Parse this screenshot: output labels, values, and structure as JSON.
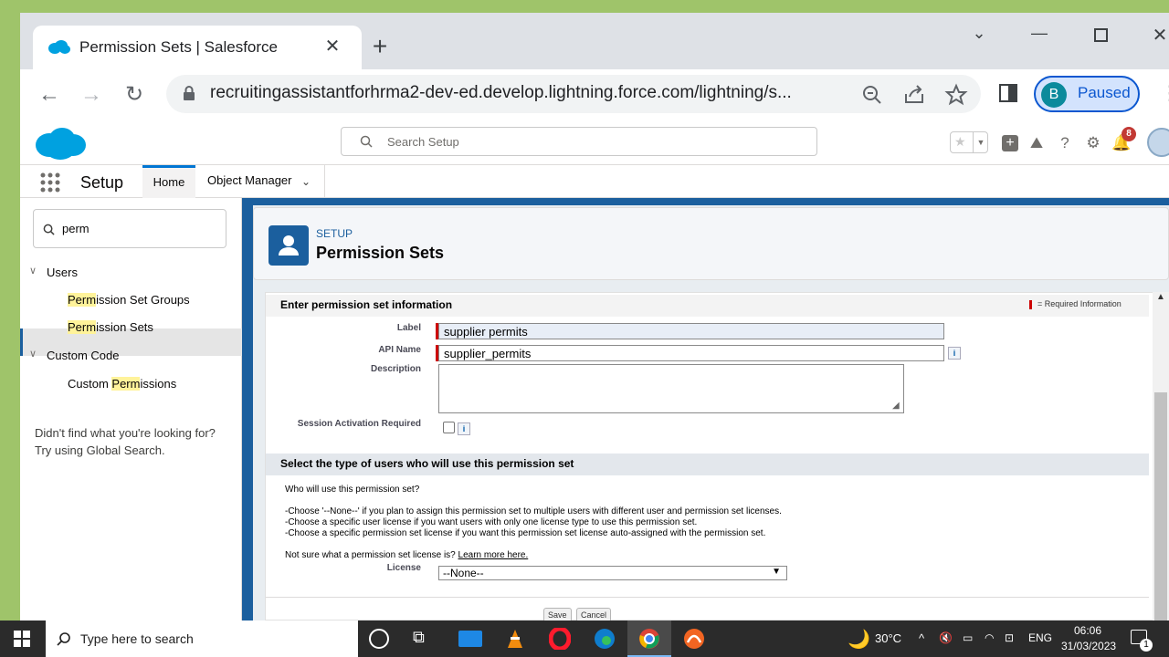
{
  "browser": {
    "tab_title": "Permission Sets | Salesforce",
    "url": "recruitingassistantforhrma2-dev-ed.develop.lightning.force.com/lightning/s...",
    "profile_initial": "B",
    "profile_status": "Paused"
  },
  "header": {
    "search_placeholder": "Search Setup",
    "notification_count": "8"
  },
  "subnav": {
    "app_name": "Setup",
    "tab_home": "Home",
    "tab_object_manager": "Object Manager"
  },
  "sidebar": {
    "quick_find_value": "perm",
    "group_users": "Users",
    "item_psg_hl": "Perm",
    "item_psg_rest": "ission Set Groups",
    "item_ps_hl": "Perm",
    "item_ps_rest": "ission Sets",
    "group_custom_code": "Custom Code",
    "item_cp_pre": "Custom ",
    "item_cp_hl": "Perm",
    "item_cp_rest": "issions",
    "not_found_line1": "Didn't find what you're looking for?",
    "not_found_line2": "Try using Global Search."
  },
  "page": {
    "breadcrumb": "SETUP",
    "title": "Permission Sets"
  },
  "form": {
    "section1_title": "Enter permission set information",
    "required_legend": "= Required Information",
    "label_label": "Label",
    "label_value": "supplier permits",
    "api_label": "API Name",
    "api_value": "supplier_permits",
    "description_label": "Description",
    "description_value": "",
    "session_label": "Session Activation Required",
    "info_glyph": "i",
    "section2_title": "Select the type of users who will use this permission set",
    "who_question": "Who will use this permission set?",
    "help1": "-Choose '--None--' if you plan to assign this permission set to multiple users with different user and permission set licenses.",
    "help2": "-Choose a specific user license if you want users with only one license type to use this permission set.",
    "help3": "-Choose a specific permission set license if you want this permission set license auto-assigned with the permission set.",
    "not_sure": "Not sure what a permission set license is?",
    "learn_more": "Learn more here.",
    "license_label": "License",
    "license_selected": "--None--",
    "save_label": "Save",
    "cancel_label": "Cancel"
  },
  "taskbar": {
    "search_placeholder": "Type here to search",
    "temperature": "30°C",
    "language": "ENG",
    "time": "06:06",
    "date": "31/03/2023",
    "notification_count": "1"
  },
  "colors": {
    "salesforce_blue": "#1b5f9e",
    "required_red": "#c00000",
    "highlight_yellow": "#fff39a"
  }
}
